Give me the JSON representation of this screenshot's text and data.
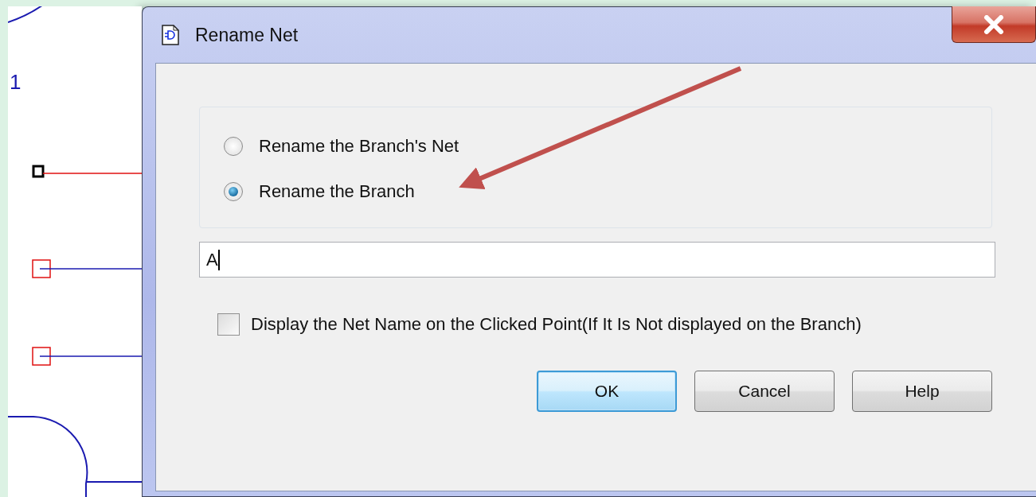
{
  "canvas": {
    "label": "1"
  },
  "window": {
    "title": "Rename Net"
  },
  "options": [
    {
      "label": "Rename the Branch's Net",
      "selected": false
    },
    {
      "label": "Rename the Branch",
      "selected": true
    }
  ],
  "name_field": {
    "value": "A"
  },
  "display_option": {
    "label": "Display the Net Name on the Clicked Point(If It Is Not displayed on the Branch)",
    "checked": false
  },
  "buttons": [
    {
      "label": "OK",
      "default": true
    },
    {
      "label": "Cancel",
      "default": false
    },
    {
      "label": "Help",
      "default": false
    }
  ]
}
